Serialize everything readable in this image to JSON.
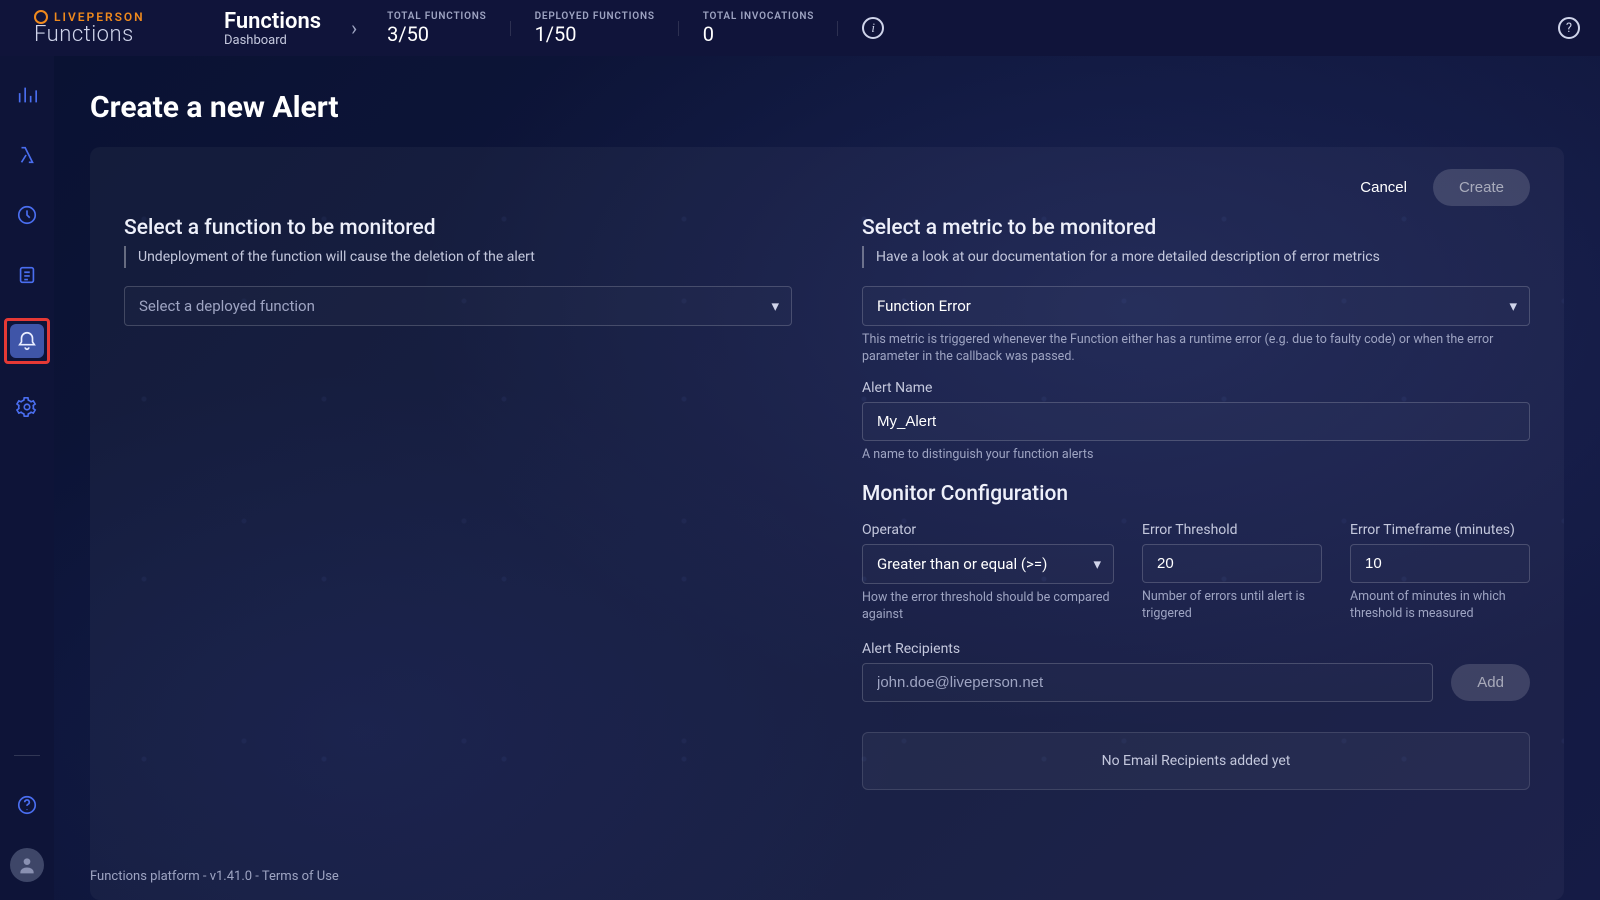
{
  "brand": {
    "top": "LIVEPERSON",
    "bottom": "Functions"
  },
  "breadcrumb": {
    "title": "Functions",
    "sub": "Dashboard"
  },
  "metrics": {
    "total_functions": {
      "label": "TOTAL FUNCTIONS",
      "value": "3/50"
    },
    "deployed_functions": {
      "label": "DEPLOYED FUNCTIONS",
      "value": "1/50"
    },
    "total_invocations": {
      "label": "TOTAL INVOCATIONS",
      "value": "0"
    }
  },
  "page": {
    "title": "Create a new Alert"
  },
  "actions": {
    "cancel": "Cancel",
    "create": "Create",
    "add": "Add"
  },
  "left": {
    "heading": "Select a function to be monitored",
    "note": "Undeployment of the function will cause the deletion of the alert",
    "function_select_placeholder": "Select a deployed function"
  },
  "right": {
    "heading": "Select a metric to be monitored",
    "note": "Have a look at our documentation for a more detailed description of error metrics",
    "metric_select_value": "Function Error",
    "metric_help": "This metric is triggered whenever the Function either has a runtime error (e.g. due to faulty code) or when the error parameter in the callback was passed.",
    "alert_name_label": "Alert Name",
    "alert_name_value": "My_Alert",
    "alert_name_help": "A name to distinguish your function alerts",
    "monitor_heading": "Monitor Configuration",
    "operator_label": "Operator",
    "operator_value": "Greater than or equal (>=)",
    "operator_help": "How the error threshold should be compared against",
    "threshold_label": "Error Threshold",
    "threshold_value": "20",
    "threshold_help": "Number of errors until alert is triggered",
    "timeframe_label": "Error Timeframe (minutes)",
    "timeframe_value": "10",
    "timeframe_help": "Amount of minutes in which threshold is measured",
    "recipients_label": "Alert Recipients",
    "recipients_placeholder": "john.doe@liveperson.net",
    "recipients_empty": "No Email Recipients added yet"
  },
  "footer": {
    "text_a": "Functions platform - v1.41.0 - ",
    "terms": "Terms of Use"
  }
}
